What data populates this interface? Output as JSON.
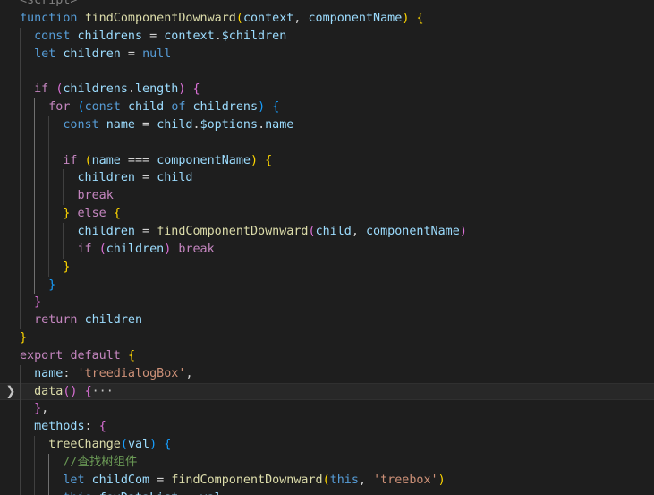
{
  "colors": {
    "background": "#1e1e1e",
    "keyword": "#569cd6",
    "control": "#c586c0",
    "function": "#dcdcaa",
    "variable": "#9cdcfe",
    "string": "#ce9178",
    "comment": "#6a9955",
    "default": "#d4d4d4",
    "bracket_gold": "#ffd700",
    "bracket_violet": "#da70d6",
    "bracket_blue": "#179fff",
    "fold_chevron": "#c5c5c5"
  },
  "lines": [
    {
      "tokens": [
        [
          "<script>",
          "#808080"
        ]
      ]
    },
    {
      "tokens": [
        [
          "function",
          "#569cd6"
        ],
        [
          " ",
          "#d4d4d4"
        ],
        [
          "findComponentDownward",
          "#dcdcaa"
        ],
        [
          "(",
          "#ffd700"
        ],
        [
          "context",
          "#9cdcfe"
        ],
        [
          ", ",
          "#d4d4d4"
        ],
        [
          "componentName",
          "#9cdcfe"
        ],
        [
          ")",
          "#ffd700"
        ],
        [
          " ",
          "#d4d4d4"
        ],
        [
          "{",
          "#ffd700"
        ]
      ]
    },
    {
      "tokens": [
        [
          "  ",
          "#d4d4d4"
        ],
        [
          "const",
          "#569cd6"
        ],
        [
          " ",
          "#d4d4d4"
        ],
        [
          "childrens",
          "#9cdcfe"
        ],
        [
          " = ",
          "#d4d4d4"
        ],
        [
          "context",
          "#9cdcfe"
        ],
        [
          ".",
          "#d4d4d4"
        ],
        [
          "$children",
          "#9cdcfe"
        ]
      ]
    },
    {
      "tokens": [
        [
          "  ",
          "#d4d4d4"
        ],
        [
          "let",
          "#569cd6"
        ],
        [
          " ",
          "#d4d4d4"
        ],
        [
          "children",
          "#9cdcfe"
        ],
        [
          " = ",
          "#d4d4d4"
        ],
        [
          "null",
          "#569cd6"
        ]
      ]
    },
    {
      "tokens": []
    },
    {
      "tokens": [
        [
          "  ",
          "#d4d4d4"
        ],
        [
          "if",
          "#c586c0"
        ],
        [
          " ",
          "#d4d4d4"
        ],
        [
          "(",
          "#da70d6"
        ],
        [
          "childrens",
          "#9cdcfe"
        ],
        [
          ".",
          "#d4d4d4"
        ],
        [
          "length",
          "#9cdcfe"
        ],
        [
          ")",
          "#da70d6"
        ],
        [
          " ",
          "#d4d4d4"
        ],
        [
          "{",
          "#da70d6"
        ]
      ]
    },
    {
      "tokens": [
        [
          "    ",
          "#d4d4d4"
        ],
        [
          "for",
          "#c586c0"
        ],
        [
          " ",
          "#d4d4d4"
        ],
        [
          "(",
          "#179fff"
        ],
        [
          "const",
          "#569cd6"
        ],
        [
          " ",
          "#d4d4d4"
        ],
        [
          "child",
          "#9cdcfe"
        ],
        [
          " ",
          "#d4d4d4"
        ],
        [
          "of",
          "#569cd6"
        ],
        [
          " ",
          "#d4d4d4"
        ],
        [
          "childrens",
          "#9cdcfe"
        ],
        [
          ")",
          "#179fff"
        ],
        [
          " ",
          "#d4d4d4"
        ],
        [
          "{",
          "#179fff"
        ]
      ]
    },
    {
      "tokens": [
        [
          "      ",
          "#d4d4d4"
        ],
        [
          "const",
          "#569cd6"
        ],
        [
          " ",
          "#d4d4d4"
        ],
        [
          "name",
          "#9cdcfe"
        ],
        [
          " = ",
          "#d4d4d4"
        ],
        [
          "child",
          "#9cdcfe"
        ],
        [
          ".",
          "#d4d4d4"
        ],
        [
          "$options",
          "#9cdcfe"
        ],
        [
          ".",
          "#d4d4d4"
        ],
        [
          "name",
          "#9cdcfe"
        ]
      ]
    },
    {
      "tokens": []
    },
    {
      "tokens": [
        [
          "      ",
          "#d4d4d4"
        ],
        [
          "if",
          "#c586c0"
        ],
        [
          " ",
          "#d4d4d4"
        ],
        [
          "(",
          "#ffd700"
        ],
        [
          "name",
          "#9cdcfe"
        ],
        [
          " === ",
          "#d4d4d4"
        ],
        [
          "componentName",
          "#9cdcfe"
        ],
        [
          ")",
          "#ffd700"
        ],
        [
          " ",
          "#d4d4d4"
        ],
        [
          "{",
          "#ffd700"
        ]
      ]
    },
    {
      "tokens": [
        [
          "        ",
          "#d4d4d4"
        ],
        [
          "children",
          "#9cdcfe"
        ],
        [
          " = ",
          "#d4d4d4"
        ],
        [
          "child",
          "#9cdcfe"
        ]
      ]
    },
    {
      "tokens": [
        [
          "        ",
          "#d4d4d4"
        ],
        [
          "break",
          "#c586c0"
        ]
      ]
    },
    {
      "tokens": [
        [
          "      ",
          "#d4d4d4"
        ],
        [
          "}",
          "#ffd700"
        ],
        [
          " ",
          "#d4d4d4"
        ],
        [
          "else",
          "#c586c0"
        ],
        [
          " ",
          "#d4d4d4"
        ],
        [
          "{",
          "#ffd700"
        ]
      ]
    },
    {
      "tokens": [
        [
          "        ",
          "#d4d4d4"
        ],
        [
          "children",
          "#9cdcfe"
        ],
        [
          " = ",
          "#d4d4d4"
        ],
        [
          "findComponentDownward",
          "#dcdcaa"
        ],
        [
          "(",
          "#da70d6"
        ],
        [
          "child",
          "#9cdcfe"
        ],
        [
          ", ",
          "#d4d4d4"
        ],
        [
          "componentName",
          "#9cdcfe"
        ],
        [
          ")",
          "#da70d6"
        ]
      ]
    },
    {
      "tokens": [
        [
          "        ",
          "#d4d4d4"
        ],
        [
          "if",
          "#c586c0"
        ],
        [
          " ",
          "#d4d4d4"
        ],
        [
          "(",
          "#da70d6"
        ],
        [
          "children",
          "#9cdcfe"
        ],
        [
          ")",
          "#da70d6"
        ],
        [
          " ",
          "#d4d4d4"
        ],
        [
          "break",
          "#c586c0"
        ]
      ]
    },
    {
      "tokens": [
        [
          "      ",
          "#d4d4d4"
        ],
        [
          "}",
          "#ffd700"
        ]
      ]
    },
    {
      "tokens": [
        [
          "    ",
          "#d4d4d4"
        ],
        [
          "}",
          "#179fff"
        ]
      ]
    },
    {
      "tokens": [
        [
          "  ",
          "#d4d4d4"
        ],
        [
          "}",
          "#da70d6"
        ]
      ]
    },
    {
      "tokens": [
        [
          "  ",
          "#d4d4d4"
        ],
        [
          "return",
          "#c586c0"
        ],
        [
          " ",
          "#d4d4d4"
        ],
        [
          "children",
          "#9cdcfe"
        ]
      ]
    },
    {
      "tokens": [
        [
          "}",
          "#ffd700"
        ]
      ]
    },
    {
      "tokens": [
        [
          "export",
          "#c586c0"
        ],
        [
          " ",
          "#d4d4d4"
        ],
        [
          "default",
          "#c586c0"
        ],
        [
          " ",
          "#d4d4d4"
        ],
        [
          "{",
          "#ffd700"
        ]
      ]
    },
    {
      "tokens": [
        [
          "  ",
          "#d4d4d4"
        ],
        [
          "name",
          "#9cdcfe"
        ],
        [
          ": ",
          "#d4d4d4"
        ],
        [
          "'treedialogBox'",
          "#ce9178"
        ],
        [
          ",",
          "#d4d4d4"
        ]
      ]
    },
    {
      "tokens": [
        [
          "  ",
          "#d4d4d4"
        ],
        [
          "data",
          "#dcdcaa"
        ],
        [
          "()",
          "#da70d6"
        ],
        [
          " ",
          "#d4d4d4"
        ],
        [
          "{",
          "#da70d6"
        ],
        [
          "···",
          "#c5c5c5"
        ]
      ],
      "current": true,
      "folded": true
    },
    {
      "tokens": [
        [
          "  ",
          "#d4d4d4"
        ],
        [
          "}",
          "#da70d6"
        ],
        [
          ",",
          "#d4d4d4"
        ]
      ]
    },
    {
      "tokens": [
        [
          "  ",
          "#d4d4d4"
        ],
        [
          "methods",
          "#9cdcfe"
        ],
        [
          ": ",
          "#d4d4d4"
        ],
        [
          "{",
          "#da70d6"
        ]
      ]
    },
    {
      "tokens": [
        [
          "    ",
          "#d4d4d4"
        ],
        [
          "treeChange",
          "#dcdcaa"
        ],
        [
          "(",
          "#179fff"
        ],
        [
          "val",
          "#9cdcfe"
        ],
        [
          ")",
          "#179fff"
        ],
        [
          " ",
          "#d4d4d4"
        ],
        [
          "{",
          "#179fff"
        ]
      ]
    },
    {
      "tokens": [
        [
          "      ",
          "#d4d4d4"
        ],
        [
          "//查找树组件",
          "#6a9955"
        ]
      ]
    },
    {
      "tokens": [
        [
          "      ",
          "#d4d4d4"
        ],
        [
          "let",
          "#569cd6"
        ],
        [
          " ",
          "#d4d4d4"
        ],
        [
          "childCom",
          "#9cdcfe"
        ],
        [
          " = ",
          "#d4d4d4"
        ],
        [
          "findComponentDownward",
          "#dcdcaa"
        ],
        [
          "(",
          "#ffd700"
        ],
        [
          "this",
          "#569cd6"
        ],
        [
          ", ",
          "#d4d4d4"
        ],
        [
          "'treebox'",
          "#ce9178"
        ],
        [
          ")",
          "#ffd700"
        ]
      ]
    },
    {
      "tokens": [
        [
          "      ",
          "#d4d4d4"
        ],
        [
          "this",
          "#569cd6"
        ],
        [
          ".",
          "#d4d4d4"
        ],
        [
          "fexDataList",
          "#9cdcfe"
        ],
        [
          " = ",
          "#d4d4d4"
        ],
        [
          "val",
          "#9cdcfe"
        ]
      ]
    }
  ]
}
